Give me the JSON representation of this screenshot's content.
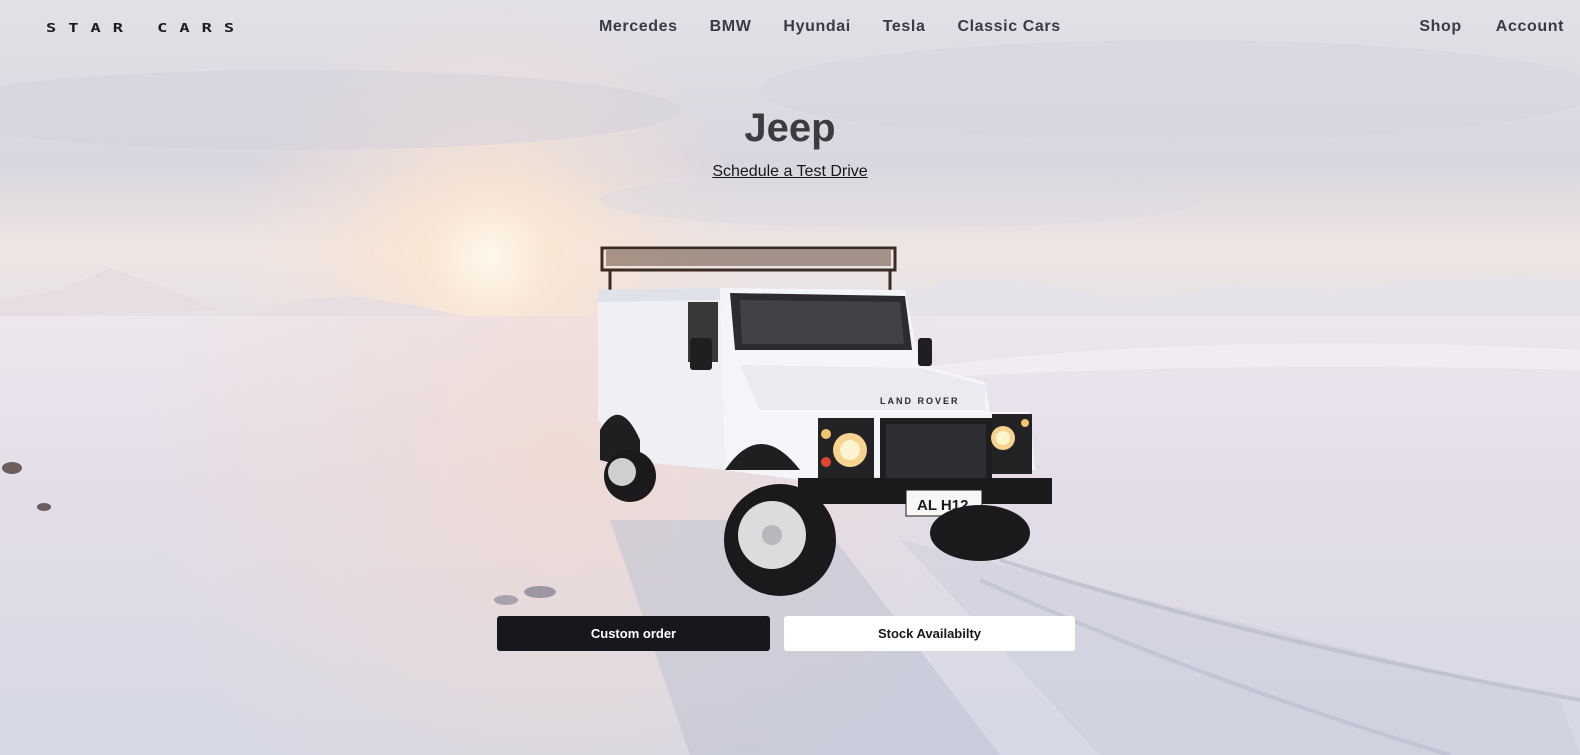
{
  "brand": "STAR CARS",
  "nav": {
    "center": [
      "Mercedes",
      "BMW",
      "Hyundai",
      "Tesla",
      "Classic Cars"
    ],
    "right": [
      "Shop",
      "Account"
    ]
  },
  "hero": {
    "title": "Jeep",
    "test_drive_link": "Schedule a Test Drive",
    "plate_text": "AL H12",
    "vehicle_badge": "LAND ROVER",
    "buttons": {
      "custom_order": "Custom order",
      "stock_availability": "Stock Availabilty"
    }
  },
  "colors": {
    "button_dark": "#16181d",
    "button_light": "#ffffff",
    "nav_text": "#3a3a42",
    "title_text": "#3b3b40"
  }
}
